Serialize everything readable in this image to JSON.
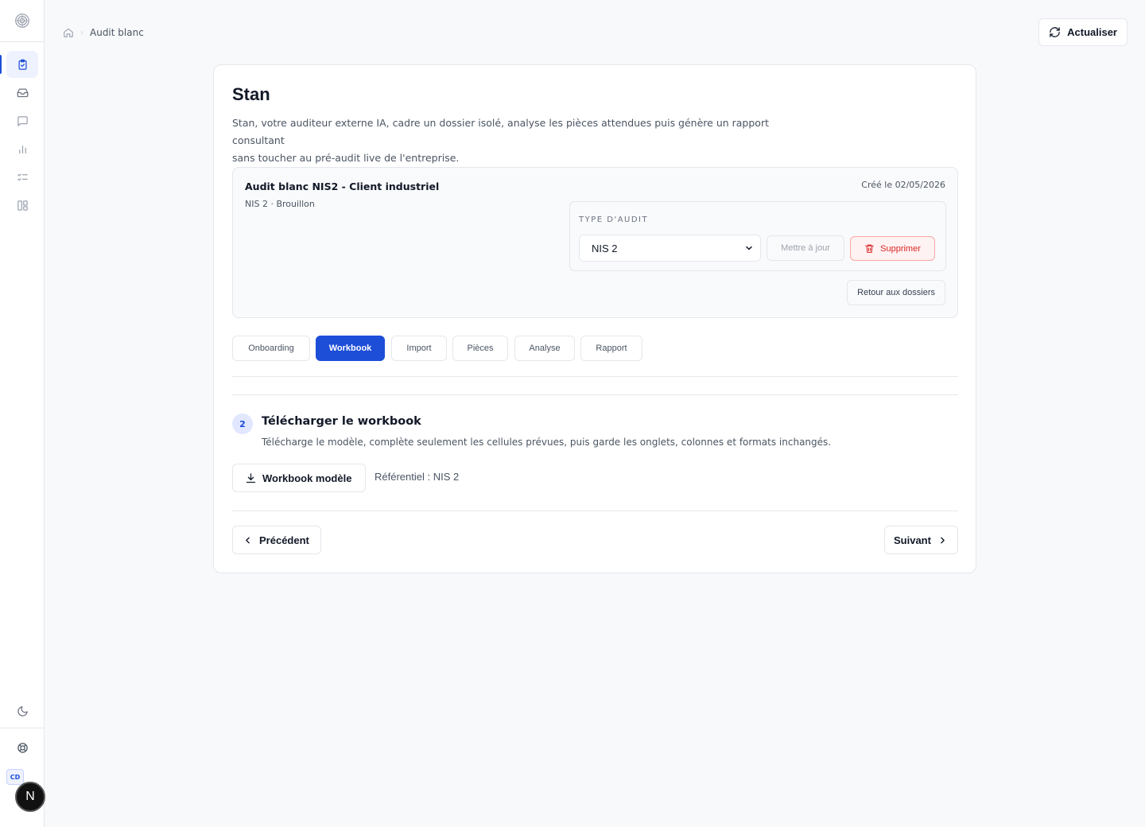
{
  "sidebar": {
    "logo_icon": "stacked-circles-logo",
    "nav": [
      {
        "icon": "clipboard-check-icon",
        "active": true
      },
      {
        "icon": "inbox-icon",
        "active": false
      },
      {
        "icon": "message-square-icon",
        "active": false
      },
      {
        "icon": "bar-chart-icon",
        "active": false
      },
      {
        "icon": "list-checks-icon",
        "active": false
      },
      {
        "icon": "layout-columns-icon",
        "active": false
      }
    ],
    "avatar_initials": "CD",
    "bottom_badge": "N"
  },
  "header": {
    "breadcrumb": {
      "current": "Audit blanc"
    },
    "refresh_label": "Actualiser"
  },
  "page": {
    "title": "Stan",
    "subtitle_line1": "Stan, votre auditeur externe IA, cadre un dossier isolé, analyse les pièces attendues puis génère un rapport consultant",
    "subtitle_line2": "sans toucher au pré-audit live de l'entreprise."
  },
  "dossier": {
    "title": "Audit blanc NIS2 - Client industriel",
    "meta": "NIS 2 · Brouillon",
    "created": "Créé le 02/05/2026",
    "type_label": "TYPE D'AUDIT",
    "type_value": "NIS 2",
    "update_label": "Mettre à jour",
    "delete_label": "Supprimer",
    "back_label": "Retour aux dossiers"
  },
  "tabs": [
    {
      "label": "Onboarding",
      "active": false
    },
    {
      "label": "Workbook",
      "active": true
    },
    {
      "label": "Import",
      "active": false
    },
    {
      "label": "Pièces",
      "active": false
    },
    {
      "label": "Analyse",
      "active": false
    },
    {
      "label": "Rapport",
      "active": false
    }
  ],
  "step": {
    "number": "2",
    "title": "Télécharger le workbook",
    "description": "Télécharge le modèle, complète seulement les cellules prévues, puis garde les onglets, colonnes et formats inchangés.",
    "workbook_label": "Workbook modèle",
    "referentiel": "Référentiel : NIS 2"
  },
  "nav": {
    "prev_label": "Précédent",
    "next_label": "Suivant"
  },
  "colors": {
    "accent": "#1d4ed8",
    "danger": "#dc2626",
    "border": "#e5e7eb"
  }
}
